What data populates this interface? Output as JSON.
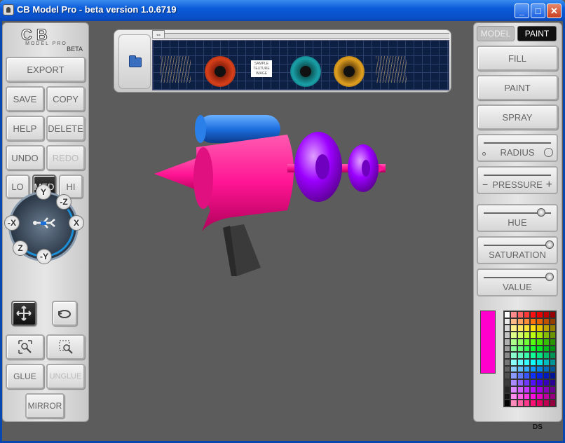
{
  "window": {
    "title": "CB Model Pro - beta version 1.0.6719",
    "minimize": "_",
    "maximize": "□",
    "close": "✕"
  },
  "logo": {
    "main": "CB",
    "sub": "MODEL PRO",
    "beta": "BETA"
  },
  "left": {
    "export": "EXPORT",
    "save": "SAVE",
    "copy": "COPY",
    "help": "HELP",
    "delete": "DELETE",
    "undo": "UNDO",
    "redo": "REDO",
    "lo": "LO",
    "med": "MED",
    "hi": "HI",
    "glue": "GLUE",
    "unglue": "UNGLUE",
    "mirror": "MIRROR",
    "axes": {
      "y": "Y",
      "z": "-Z",
      "nx": "-X",
      "x": "X",
      "zp": "Z",
      "ny": "-Y"
    }
  },
  "strip": {
    "handle": "⇔",
    "label_text": "SAMPLE TEXTURE IMAGE"
  },
  "right": {
    "tabs": {
      "model": "MODEL",
      "paint": "PAINT"
    },
    "fill": "FILL",
    "paint": "PAINT",
    "spray": "SPRAY",
    "radius": "RADIUS",
    "pressure": "PRESSURE",
    "pressure_minus": "−",
    "pressure_plus": "+",
    "hue": "HUE",
    "saturation": "SATURATION",
    "value": "VALUE",
    "slider_levels": {
      "radius": 1.0,
      "pressure": 1.0,
      "hue": 0.88,
      "saturation": 1.0,
      "value": 1.0
    },
    "current_color": "#ff00cc"
  },
  "colors": {
    "accent": "#0a5bd8",
    "pink": "#ff1493",
    "purple": "#9b00ff",
    "blue": "#1e6fe0"
  },
  "footer": {
    "brand": "DS"
  }
}
